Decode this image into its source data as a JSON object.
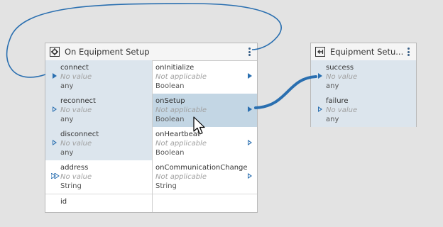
{
  "node_main": {
    "title": "On Equipment Setup",
    "icon": "gear-icon",
    "inputs": [
      {
        "name": "connect",
        "value": "No value",
        "type": "any"
      },
      {
        "name": "reconnect",
        "value": "No value",
        "type": "any"
      },
      {
        "name": "disconnect",
        "value": "No value",
        "type": "any"
      },
      {
        "name": "address",
        "value": "No value",
        "type": "String"
      },
      {
        "name": "id"
      }
    ],
    "outputs": [
      {
        "name": "onInitialize",
        "value": "Not applicable",
        "type": "Boolean"
      },
      {
        "name": "onSetup",
        "value": "Not applicable",
        "type": "Boolean"
      },
      {
        "name": "onHeartbeat",
        "value": "Not applicable",
        "type": "Boolean"
      },
      {
        "name": "onCommunicationChange",
        "value": "Not applicable",
        "type": "String"
      }
    ]
  },
  "node_target": {
    "title": "Equipment Setu...",
    "icon": "enter-icon",
    "inputs": [
      {
        "name": "success",
        "value": "No value",
        "type": "any"
      },
      {
        "name": "failure",
        "value": "No value",
        "type": "any"
      }
    ]
  },
  "colors": {
    "wire": "#2a6fb0",
    "selected_row": "#c3d6e4",
    "shaded_row": "#dce5ed",
    "canvas": "#e3e3e3"
  }
}
